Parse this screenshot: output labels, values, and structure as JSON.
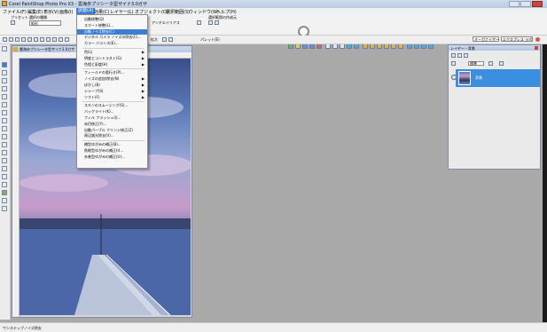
{
  "window": {
    "title": "Corel PaintShop Photo Pro X3 - 雲海歩プツシータ型ザイナ3.0ガザ"
  },
  "menubar": {
    "items": [
      {
        "label": "ファイル(F)"
      },
      {
        "label": "編集(E)"
      },
      {
        "label": "表示(V)"
      },
      {
        "label": "画像(I)"
      },
      {
        "label": "調整(A)"
      },
      {
        "label": "効果(C)"
      },
      {
        "label": "レイヤー(L)"
      },
      {
        "label": "オブジェクト(O)"
      },
      {
        "label": "選択範囲(S)"
      },
      {
        "label": "ウィンドウ(W)"
      },
      {
        "label": "ヘルプ(H)"
      }
    ]
  },
  "options": {
    "preset_label": "プリセット",
    "selection_type_label": "選択の種類",
    "selection_type_value": "矩形",
    "antialias_label": "アンチエイリアス",
    "selection_mode_label": "選択範囲の作成元"
  },
  "toolbar2": {
    "zoom_label": "拡大",
    "palette_label": "パレット(E)",
    "organizer_button": "オーガナイザー",
    "express_lab_button": "エクスプレス ラボ"
  },
  "adjust_menu": {
    "items": [
      {
        "label": "自動修整(Q)",
        "arrow": false,
        "highlight": false
      },
      {
        "label": "スマート修整(L)...",
        "arrow": false,
        "highlight": false
      },
      {
        "label": "自動ノイズ除去(C)",
        "arrow": false,
        "highlight": true
      },
      {
        "label": "デジタル カメラ ノイズの除去(C)...",
        "arrow": false,
        "highlight": false
      },
      {
        "label": "カラー バランス(E)...",
        "arrow": false,
        "highlight": false
      },
      {
        "sep": true
      },
      {
        "label": "色(L)",
        "arrow": true,
        "highlight": false
      },
      {
        "label": "明度とコントラスト(G)",
        "arrow": true,
        "highlight": false
      },
      {
        "label": "色相と彩度(H)",
        "arrow": true,
        "highlight": false
      },
      {
        "sep": true
      },
      {
        "label": "フィールドの奥行き(P)...",
        "arrow": false,
        "highlight": false
      },
      {
        "label": "ノイズの追加/除去(N)",
        "arrow": true,
        "highlight": false
      },
      {
        "label": "ぼかし(B)",
        "arrow": true,
        "highlight": false
      },
      {
        "label": "シャープ(S)",
        "arrow": true,
        "highlight": false
      },
      {
        "label": "ソフト(F)",
        "arrow": true,
        "highlight": false
      },
      {
        "sep": true
      },
      {
        "label": "スキンのスムージング(S)...",
        "arrow": false,
        "highlight": false
      },
      {
        "label": "バックライト(K)...",
        "arrow": false,
        "highlight": false
      },
      {
        "label": "フィル フラッシュ(I)...",
        "arrow": false,
        "highlight": false
      },
      {
        "label": "赤目修正(Y)...",
        "arrow": false,
        "highlight": false
      },
      {
        "label": "自動パープル フリンジ修正(Z)",
        "arrow": false,
        "highlight": false
      },
      {
        "label": "周辺減光除去(V)...",
        "arrow": false,
        "highlight": false
      },
      {
        "sep": true
      },
      {
        "label": "樽型ゆがみの補正(B)...",
        "arrow": false,
        "highlight": false
      },
      {
        "label": "魚眼型ゆがみの補正(I)...",
        "arrow": false,
        "highlight": false
      },
      {
        "label": "糸巻型ゆがみの補正(U)...",
        "arrow": false,
        "highlight": false
      }
    ]
  },
  "image_window": {
    "title": "雲海歩プツシータ型ザイナ3.0ガザ"
  },
  "layers_palette": {
    "title": "レイヤー - 背景",
    "blend_label": "標準",
    "layer_name": "背景"
  },
  "status": {
    "text": "ワンステップノイズ除去"
  }
}
